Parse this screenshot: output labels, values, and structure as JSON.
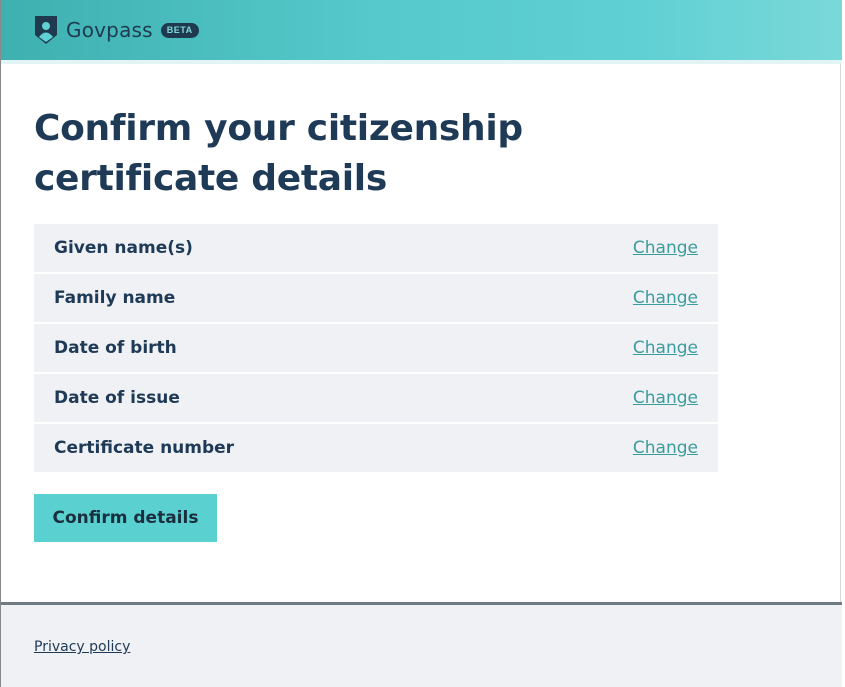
{
  "header": {
    "brand_name": "Govpass",
    "badge": "BETA",
    "logo_icon": "shield-person-icon",
    "colors": {
      "gradient_start": "#3fb0b0",
      "gradient_end": "#7ad8d8",
      "dark": "#1f3a4f"
    }
  },
  "main": {
    "title": "Confirm your citizenship certificate details",
    "rows": [
      {
        "label": "Given name(s)",
        "action": "Change"
      },
      {
        "label": "Family name",
        "action": "Change"
      },
      {
        "label": "Date of birth",
        "action": "Change"
      },
      {
        "label": "Date of issue",
        "action": "Change"
      },
      {
        "label": "Certificate number",
        "action": "Change"
      }
    ],
    "confirm_button": "Confirm details"
  },
  "footer": {
    "privacy_link": "Privacy policy"
  },
  "colors": {
    "text": "#1e3a56",
    "link": "#3b9c9d",
    "button": "#5ad0d0",
    "row_bg": "#eff1f5"
  }
}
